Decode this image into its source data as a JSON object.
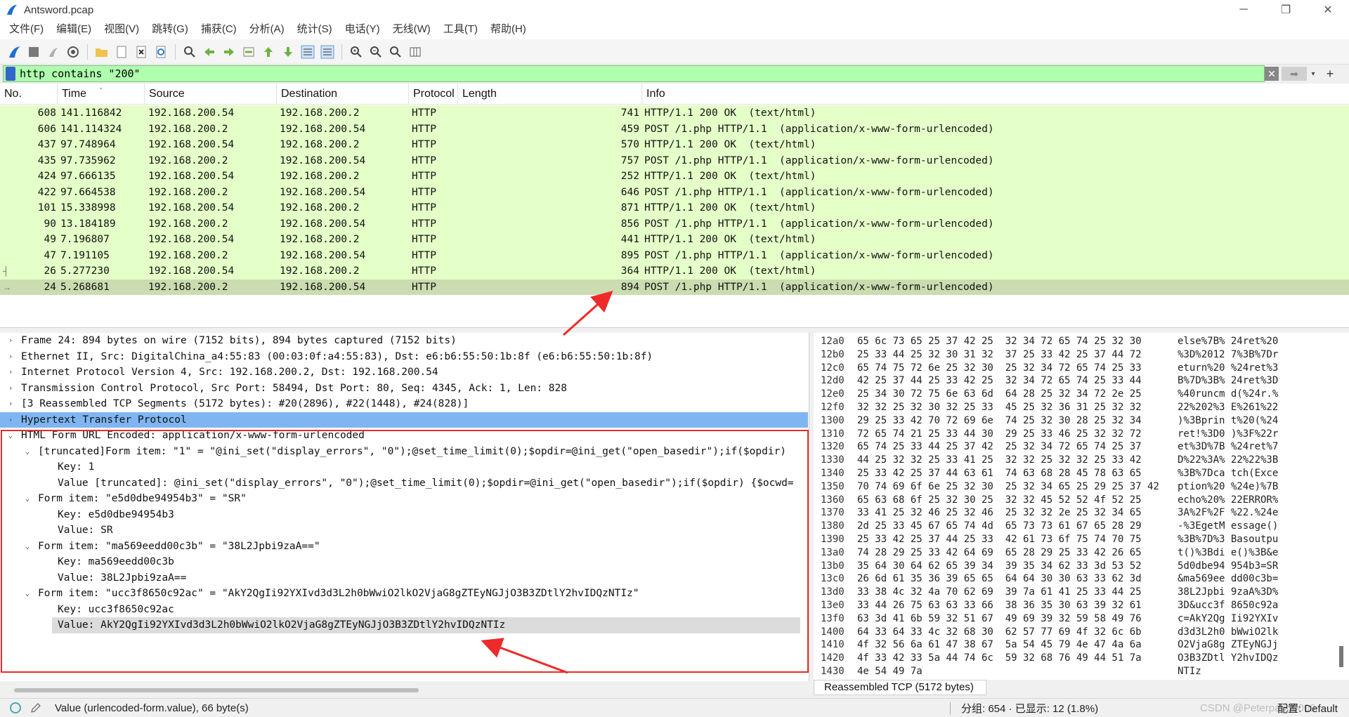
{
  "window": {
    "title": "Antsword.pcap",
    "buttons": [
      "─",
      "❐",
      "✕"
    ]
  },
  "menu": [
    "文件(F)",
    "编辑(E)",
    "视图(V)",
    "跳转(G)",
    "捕获(C)",
    "分析(A)",
    "统计(S)",
    "电话(Y)",
    "无线(W)",
    "工具(T)",
    "帮助(H)"
  ],
  "filter": {
    "value": "http contains \"200\"",
    "clear_label": "✕",
    "apply_label": "➡",
    "dropdown_label": "▾",
    "add_label": "+"
  },
  "packet_list": {
    "columns": [
      "No.",
      "Time",
      "Source",
      "Destination",
      "Protocol",
      "Length",
      "Info"
    ],
    "rows": [
      {
        "no": "608",
        "time": "141.116842",
        "src": "192.168.200.54",
        "dst": "192.168.200.2",
        "proto": "HTTP",
        "len": "741",
        "info": "HTTP/1.1 200 OK  (text/html)"
      },
      {
        "no": "606",
        "time": "141.114324",
        "src": "192.168.200.2",
        "dst": "192.168.200.54",
        "proto": "HTTP",
        "len": "459",
        "info": "POST /1.php HTTP/1.1  (application/x-www-form-urlencoded)"
      },
      {
        "no": "437",
        "time": "97.748964",
        "src": "192.168.200.54",
        "dst": "192.168.200.2",
        "proto": "HTTP",
        "len": "570",
        "info": "HTTP/1.1 200 OK  (text/html)"
      },
      {
        "no": "435",
        "time": "97.735962",
        "src": "192.168.200.2",
        "dst": "192.168.200.54",
        "proto": "HTTP",
        "len": "757",
        "info": "POST /1.php HTTP/1.1  (application/x-www-form-urlencoded)"
      },
      {
        "no": "424",
        "time": "97.666135",
        "src": "192.168.200.54",
        "dst": "192.168.200.2",
        "proto": "HTTP",
        "len": "252",
        "info": "HTTP/1.1 200 OK  (text/html)"
      },
      {
        "no": "422",
        "time": "97.664538",
        "src": "192.168.200.2",
        "dst": "192.168.200.54",
        "proto": "HTTP",
        "len": "646",
        "info": "POST /1.php HTTP/1.1  (application/x-www-form-urlencoded)"
      },
      {
        "no": "101",
        "time": "15.338998",
        "src": "192.168.200.54",
        "dst": "192.168.200.2",
        "proto": "HTTP",
        "len": "871",
        "info": "HTTP/1.1 200 OK  (text/html)"
      },
      {
        "no": "90",
        "time": "13.184189",
        "src": "192.168.200.2",
        "dst": "192.168.200.54",
        "proto": "HTTP",
        "len": "856",
        "info": "POST /1.php HTTP/1.1  (application/x-www-form-urlencoded)"
      },
      {
        "no": "49",
        "time": "7.196807",
        "src": "192.168.200.54",
        "dst": "192.168.200.2",
        "proto": "HTTP",
        "len": "441",
        "info": "HTTP/1.1 200 OK  (text/html)"
      },
      {
        "no": "47",
        "time": "7.191105",
        "src": "192.168.200.2",
        "dst": "192.168.200.54",
        "proto": "HTTP",
        "len": "895",
        "info": "POST /1.php HTTP/1.1  (application/x-www-form-urlencoded)"
      },
      {
        "no": "26",
        "time": "5.277230",
        "src": "192.168.200.54",
        "dst": "192.168.200.2",
        "proto": "HTTP",
        "len": "364",
        "info": "HTTP/1.1 200 OK  (text/html)"
      },
      {
        "no": "24",
        "time": "5.268681",
        "src": "192.168.200.2",
        "dst": "192.168.200.54",
        "proto": "HTTP",
        "len": "894",
        "info": "POST /1.php HTTP/1.1  (application/x-www-form-urlencoded)"
      }
    ],
    "selected_row_no": "24"
  },
  "details": {
    "lines": [
      {
        "text": "Frame 24: 894 bytes on wire (7152 bits), 894 bytes captured (7152 bits)",
        "expander": "›",
        "highlight": false
      },
      {
        "text": "Ethernet II, Src: DigitalChina_a4:55:83 (00:03:0f:a4:55:83), Dst: e6:b6:55:50:1b:8f (e6:b6:55:50:1b:8f)",
        "expander": "›",
        "highlight": false
      },
      {
        "text": "Internet Protocol Version 4, Src: 192.168.200.2, Dst: 192.168.200.54",
        "expander": "›",
        "highlight": false
      },
      {
        "text": "Transmission Control Protocol, Src Port: 58494, Dst Port: 80, Seq: 4345, Ack: 1, Len: 828",
        "expander": "›",
        "highlight": false
      },
      {
        "text": "[3 Reassembled TCP Segments (5172 bytes): #20(2896), #22(1448), #24(828)]",
        "expander": "›",
        "highlight": false
      },
      {
        "text": "Hypertext Transfer Protocol",
        "expander": "›",
        "highlight": true
      },
      {
        "text": "HTML Form URL Encoded: application/x-www-form-urlencoded",
        "expander": "⌄",
        "highlight": false
      },
      {
        "text": "[truncated]Form item: \"1\" = \"@ini_set(\"display_errors\", \"0\");@set_time_limit(0);$opdir=@ini_get(\"open_basedir\");if($opdir)",
        "expander": "⌄",
        "highlight": false
      },
      {
        "text": "Key: 1",
        "expander": "",
        "highlight": false
      },
      {
        "text": "Value [truncated]: @ini_set(\"display_errors\", \"0\");@set_time_limit(0);$opdir=@ini_get(\"open_basedir\");if($opdir) {$ocwd=",
        "expander": "",
        "highlight": false
      },
      {
        "text": "Form item: \"e5d0dbe94954b3\" = \"SR\"",
        "expander": "⌄",
        "highlight": false
      },
      {
        "text": "Key: e5d0dbe94954b3",
        "expander": "",
        "highlight": false
      },
      {
        "text": "Value: SR",
        "expander": "",
        "highlight": false
      },
      {
        "text": "Form item: \"ma569eedd00c3b\" = \"38L2Jpbi9zaA==\"",
        "expander": "⌄",
        "highlight": false
      },
      {
        "text": "Key: ma569eedd00c3b",
        "expander": "",
        "highlight": false
      },
      {
        "text": "Value: 38L2Jpbi9zaA==",
        "expander": "",
        "highlight": false
      },
      {
        "text": "Form item: \"ucc3f8650c92ac\" = \"AkY2QgIi92YXIvd3d3L2h0bWwiO2lkO2VjaG8gZTEyNGJjO3B3ZDtlY2hvIDQzNTIz\"",
        "expander": "⌄",
        "highlight": false
      },
      {
        "text": "Key: ucc3f8650c92ac",
        "expander": "",
        "highlight": false
      },
      {
        "text": "Value: AkY2QgIi92YXIvd3d3L2h0bWwiO2lkO2VjaG8gZTEyNGJjO3B3ZDtlY2hvIDQzNTIz",
        "expander": "",
        "highlight": false
      }
    ]
  },
  "hex": {
    "rows": [
      {
        "off": "12a0",
        "bytes": "65 6c 73 65 25 37 42 25  32 34 72 65 74 25 32 30",
        "ascii": "else%7B% 24ret%20"
      },
      {
        "off": "12b0",
        "bytes": "25 33 44 25 32 30 31 32  37 25 33 42 25 37 44 72",
        "ascii": "%3D%2012 7%3B%7Dr"
      },
      {
        "off": "12c0",
        "bytes": "65 74 75 72 6e 25 32 30  25 32 34 72 65 74 25 33",
        "ascii": "eturn%20 %24ret%3"
      },
      {
        "off": "12d0",
        "bytes": "42 25 37 44 25 33 42 25  32 34 72 65 74 25 33 44",
        "ascii": "B%7D%3B% 24ret%3D"
      },
      {
        "off": "12e0",
        "bytes": "25 34 30 72 75 6e 63 6d  64 28 25 32 34 72 2e 25",
        "ascii": "%40runcm d(%24r.%"
      },
      {
        "off": "12f0",
        "bytes": "32 32 25 32 30 32 25 33  45 25 32 36 31 25 32 32",
        "ascii": "22%202%3 E%261%22"
      },
      {
        "off": "1300",
        "bytes": "29 25 33 42 70 72 69 6e  74 25 32 30 28 25 32 34",
        "ascii": ")%3Bprin t%20(%24"
      },
      {
        "off": "1310",
        "bytes": "72 65 74 21 25 33 44 30  29 25 33 46 25 32 32 72",
        "ascii": "ret!%3D0 )%3F%22r"
      },
      {
        "off": "1320",
        "bytes": "65 74 25 33 44 25 37 42  25 32 34 72 65 74 25 37",
        "ascii": "et%3D%7B %24ret%7"
      },
      {
        "off": "1330",
        "bytes": "44 25 32 32 25 33 41 25  32 32 25 32 32 25 33 42",
        "ascii": "D%22%3A% 22%22%3B"
      },
      {
        "off": "1340",
        "bytes": "25 33 42 25 37 44 63 61  74 63 68 28 45 78 63 65",
        "ascii": "%3B%7Dca tch(Exce"
      },
      {
        "off": "1350",
        "bytes": "70 74 69 6f 6e 25 32 30  25 32 34 65 25 29 25 37 42",
        "ascii": "ption%20 %24e)%7B"
      },
      {
        "off": "1360",
        "bytes": "65 63 68 6f 25 32 30 25  32 32 45 52 52 4f 52 25",
        "ascii": "echo%20% 22ERROR%"
      },
      {
        "off": "1370",
        "bytes": "33 41 25 32 46 25 32 46  25 32 32 2e 25 32 34 65",
        "ascii": "3A%2F%2F %22.%24e"
      },
      {
        "off": "1380",
        "bytes": "2d 25 33 45 67 65 74 4d  65 73 73 61 67 65 28 29",
        "ascii": "-%3EgetM essage()"
      },
      {
        "off": "1390",
        "bytes": "25 33 42 25 37 44 25 33  42 61 73 6f 75 74 70 75",
        "ascii": "%3B%7D%3 Basoutpu"
      },
      {
        "off": "13a0",
        "bytes": "74 28 29 25 33 42 64 69  65 28 29 25 33 42 26 65",
        "ascii": "t()%3Bdi e()%3B&e"
      },
      {
        "off": "13b0",
        "bytes": "35 64 30 64 62 65 39 34  39 35 34 62 33 3d 53 52",
        "ascii": "5d0dbe94 954b3=SR"
      },
      {
        "off": "13c0",
        "bytes": "26 6d 61 35 36 39 65 65  64 64 30 30 63 33 62 3d",
        "ascii": "&ma569ee dd00c3b="
      },
      {
        "off": "13d0",
        "bytes": "33 38 4c 32 4a 70 62 69  39 7a 61 41 25 33 44 25",
        "ascii": "38L2Jpbi 9zaA%3D%"
      },
      {
        "off": "13e0",
        "bytes": "33 44 26 75 63 63 33 66  38 36 35 30 63 39 32 61",
        "ascii": "3D&ucc3f 8650c92a"
      },
      {
        "off": "13f0",
        "bytes": "63 3d 41 6b 59 32 51 67  49 69 39 32 59 58 49 76",
        "ascii": "c=AkY2Qg Ii92YXIv"
      },
      {
        "off": "1400",
        "bytes": "64 33 64 33 4c 32 68 30  62 57 77 69 4f 32 6c 6b",
        "ascii": "d3d3L2h0 bWwiO2lk"
      },
      {
        "off": "1410",
        "bytes": "4f 32 56 6a 61 47 38 67  5a 54 45 79 4e 47 4a 6a",
        "ascii": "O2VjaG8g ZTEyNGJj"
      },
      {
        "off": "1420",
        "bytes": "4f 33 42 33 5a 44 74 6c  59 32 68 76 49 44 51 7a",
        "ascii": "O3B3ZDtl Y2hvIDQz"
      },
      {
        "off": "1430",
        "bytes": "4e 54 49 7a",
        "ascii": "NTIz"
      }
    ],
    "tab_label": "Reassembled TCP (5172 bytes)"
  },
  "status": {
    "message": "Value (urlencoded-form.value), 66 byte(s)",
    "stats": "分组: 654 · 已显示: 12 (1.8%)",
    "watermark": "CSDN @Peterpan00000",
    "profile": "配置: Default"
  },
  "colors": {
    "packet_row": "#e4ffc7",
    "packet_row_selected": "#cbdcb0",
    "filter_valid": "#afffaf",
    "detail_highlight": "#7fb6f2",
    "annotation_red": "#ee2a2a"
  }
}
